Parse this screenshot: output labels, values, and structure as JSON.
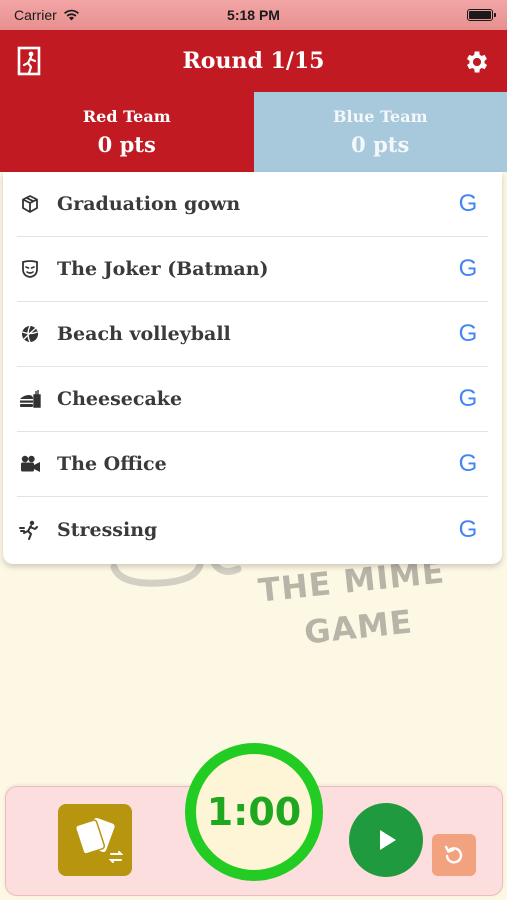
{
  "status_bar": {
    "carrier": "Carrier",
    "time": "5:18 PM"
  },
  "header": {
    "title": "Round 1/15",
    "exit_icon": "exit-door-icon",
    "settings_icon": "gear-icon"
  },
  "teams": [
    {
      "name": "Red Team",
      "score": "0 pts",
      "color": "#c11a22"
    },
    {
      "name": "Blue Team",
      "score": "0 pts",
      "color": "#a8c8dc"
    }
  ],
  "words": [
    {
      "icon": "box-icon",
      "text": "Graduation gown",
      "search": "G"
    },
    {
      "icon": "mask-icon",
      "text": "The Joker (Batman)",
      "search": "G"
    },
    {
      "icon": "ball-icon",
      "text": "Beach volleyball",
      "search": "G"
    },
    {
      "icon": "food-icon",
      "text": "Cheesecake",
      "search": "G"
    },
    {
      "icon": "video-camera-icon",
      "text": "The Office",
      "search": "G"
    },
    {
      "icon": "running-person-icon",
      "text": "Stressing",
      "search": "G"
    }
  ],
  "logo": {
    "line1": "THE MIME",
    "line2": "GAME"
  },
  "controls": {
    "timer": "1:00",
    "accent": "#22cc22"
  }
}
